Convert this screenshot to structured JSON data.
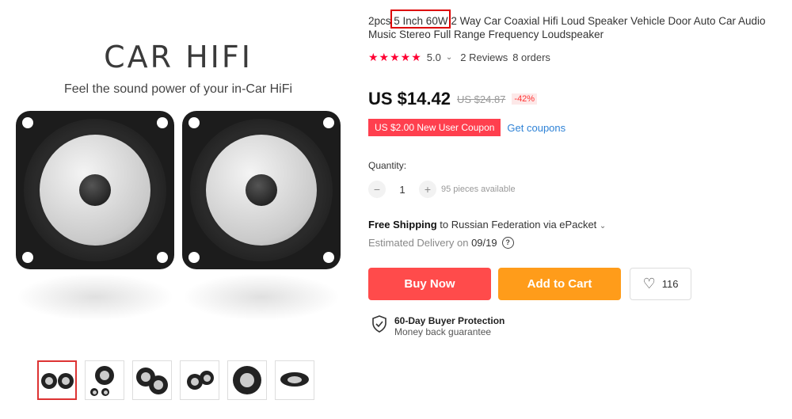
{
  "gallery": {
    "brand": "CAR HIFI",
    "tagline": "Feel the sound power of your in-Car HiFi",
    "thumbnails": [
      "thumb-1",
      "thumb-2",
      "thumb-3",
      "thumb-4",
      "thumb-5",
      "thumb-6"
    ]
  },
  "product": {
    "title_prefix": "2pcs ",
    "title_highlight": "5 Inch 60W",
    "title_rest": " 2 Way Car Coaxial Hifi Loud Speaker Vehicle Door Auto Car Audio Music Stereo Full Range Frequency Loudspeaker",
    "stars": "★★★★★",
    "rating": "5.0",
    "reviews": "2 Reviews",
    "orders": "8 orders",
    "price": "US $14.42",
    "old_price": "US $24.87",
    "discount": "-42%",
    "coupon": "US $2.00 New User Coupon",
    "get_coupons": "Get coupons",
    "quantity_label": "Quantity:",
    "quantity": "1",
    "available": "95 pieces available",
    "shipping_bold": "Free Shipping",
    "shipping_rest": " to Russian Federation via ePacket",
    "delivery_label": "Estimated Delivery on ",
    "delivery_date": "09/19",
    "buy_now": "Buy Now",
    "add_to_cart": "Add to Cart",
    "wishlist_count": "116",
    "protection_title": "60-Day Buyer Protection",
    "protection_sub": "Money back guarantee"
  },
  "colors": {
    "accent": "#ff4b4b",
    "cart": "#ff9c1a",
    "link": "#2e82d6",
    "highlight": "#dd0000"
  }
}
